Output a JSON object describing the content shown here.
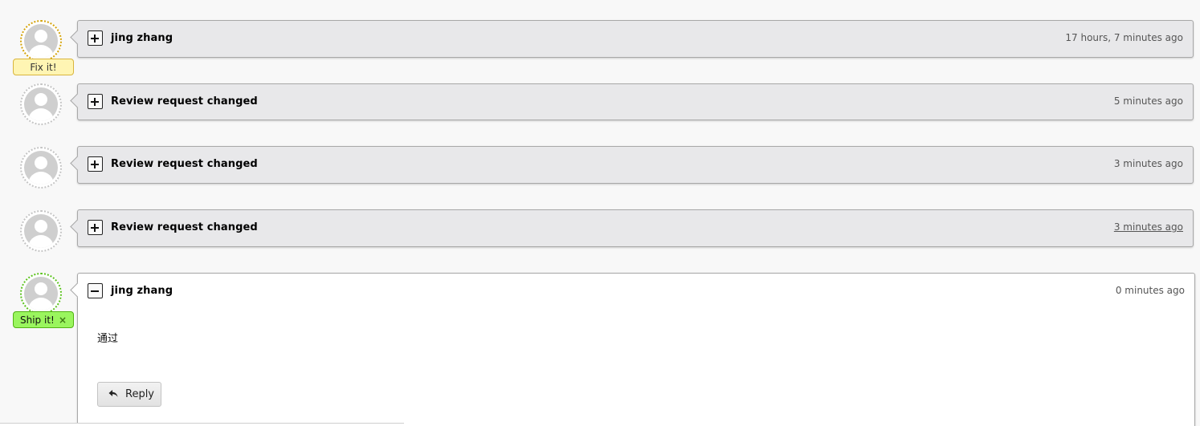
{
  "entries": [
    {
      "author": "jing zhang",
      "time": "17 hours, 7 minutes ago",
      "badge": "Fix it!",
      "expanded": false
    },
    {
      "author": "Review request changed",
      "time": "5 minutes ago",
      "expanded": false
    },
    {
      "author": "Review request changed",
      "time": "3 minutes ago",
      "expanded": false
    },
    {
      "author": "Review request changed",
      "time": "3 minutes ago",
      "expanded": false
    },
    {
      "author": "jing zhang",
      "time": "0 minutes ago",
      "badge": "Ship it!",
      "badge_close": "×",
      "body": "通过",
      "reply_label": "Reply",
      "expanded": true
    }
  ],
  "colors": {
    "fix_badge": "#fff5b3",
    "ship_badge": "#9af55e",
    "collapsed_box": "#e8e8ea",
    "expanded_box": "#ffffff"
  },
  "icons": {
    "expand": "plus-toggle-icon",
    "collapse": "minus-toggle-icon",
    "reply": "reply-arrow-icon",
    "avatar": "default-user-avatar-icon"
  }
}
